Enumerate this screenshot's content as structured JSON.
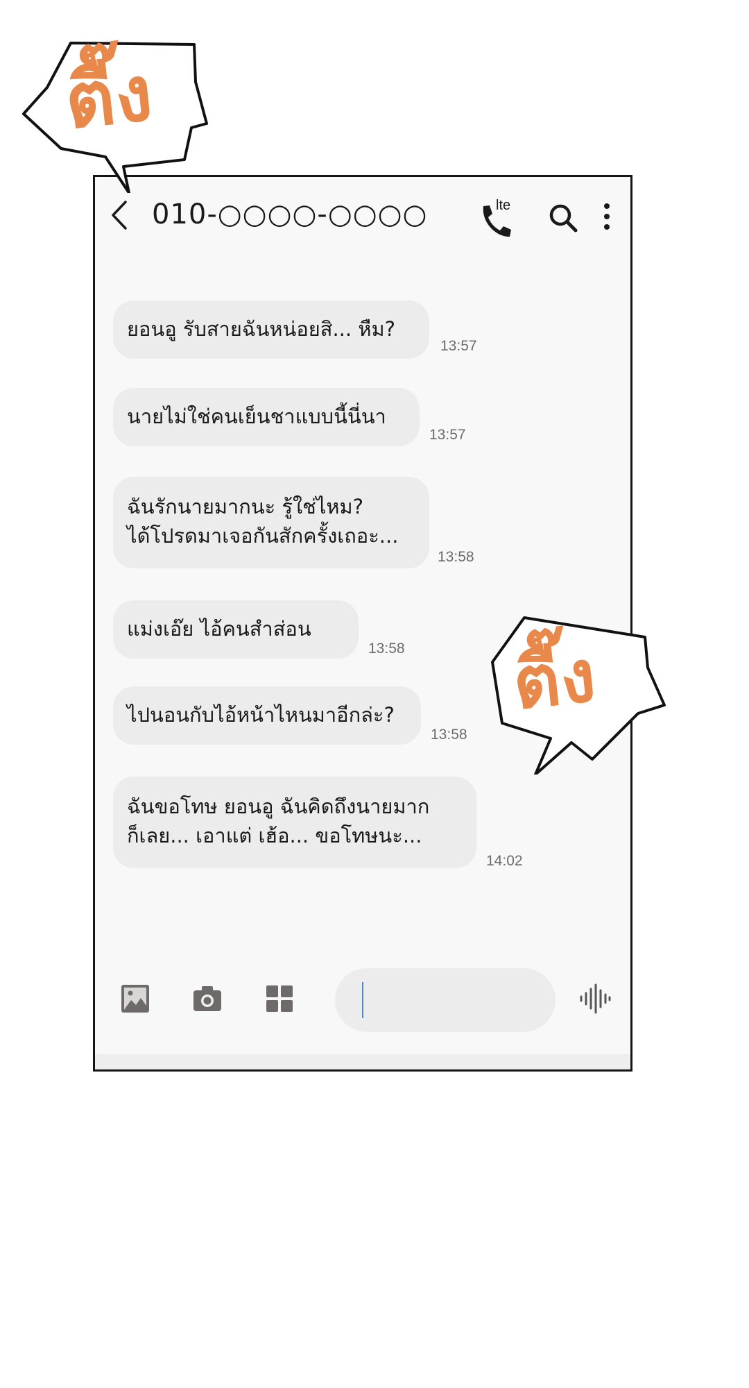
{
  "header": {
    "title": "010-○○○○-○○○○",
    "call_badge": "lte",
    "icons": [
      "back-chevron-icon",
      "phone-icon",
      "search-icon",
      "more-vertical-icon"
    ]
  },
  "messages": [
    {
      "text": "ยอนอู รับสายฉันหน่อยสิ... หืม?",
      "time": "13:57"
    },
    {
      "text": "นายไม่ใช่คนเย็นชาแบบนี้นี่นา",
      "time": "13:57"
    },
    {
      "text": "ฉันรักนายมากนะ รู้ใช่ไหม?\nได้โปรดมาเจอกันสักครั้งเถอะ...",
      "time": "13:58"
    },
    {
      "text": "แม่งเอ๊ย ไอ้คนสำส่อน",
      "time": "13:58"
    },
    {
      "text": "ไปนอนกับไอ้หน้าไหนมาอีกล่ะ?",
      "time": "13:58"
    },
    {
      "text": "ฉันขอโทษ ยอนอู ฉันคิดถึงนายมาก\nก็เลย... เอาแต่ เฮ้อ... ขอโทษนะ...",
      "time": "14:02"
    }
  ],
  "composer": {
    "input_value": "",
    "tools": [
      "gallery-icon",
      "camera-icon",
      "apps-grid-icon",
      "voice-wave-icon"
    ]
  },
  "sound_effects": [
    {
      "text": "ตื๊ง"
    },
    {
      "text": "ตื๊ง"
    }
  ],
  "colors": {
    "bubble": "#ececec",
    "screen": "#f8f8f8",
    "sfx_orange": "#e8884a",
    "frame": "#151515"
  }
}
